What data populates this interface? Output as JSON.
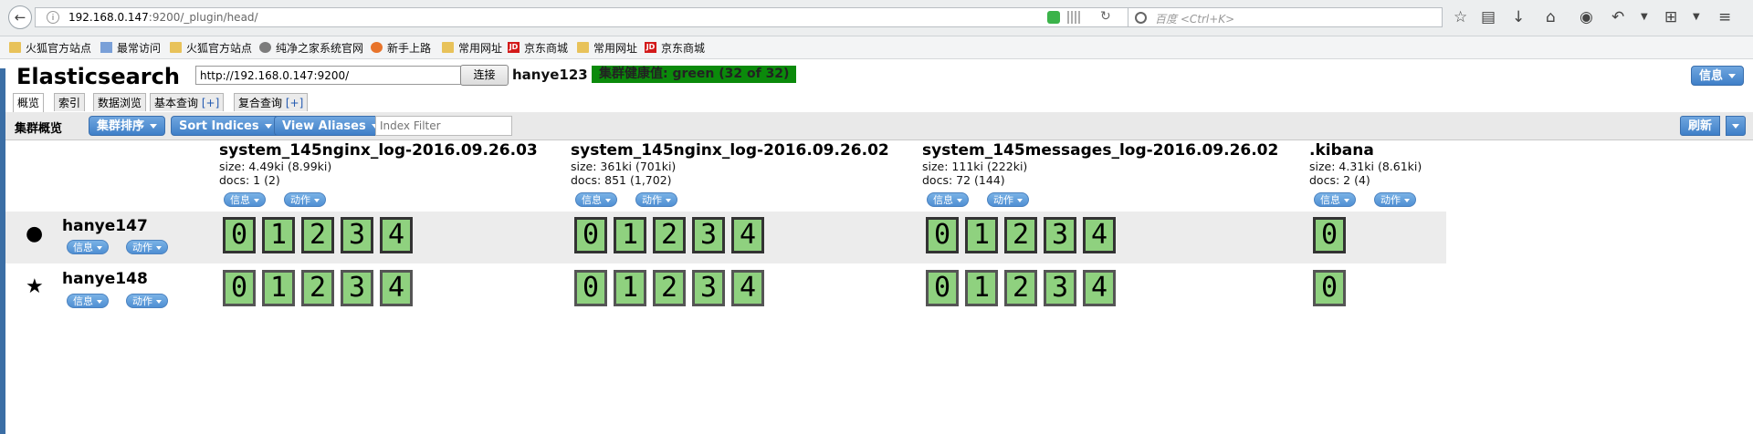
{
  "browser": {
    "url_host": "192.168.0.147",
    "url_path": ":9200/_plugin/head/",
    "search_placeholder": "百度 <Ctrl+K>",
    "bookmarks": [
      {
        "label": "火狐官方站点",
        "icon": "folder"
      },
      {
        "label": "最常访问",
        "icon": "page"
      },
      {
        "label": "火狐官方站点",
        "icon": "folder"
      },
      {
        "label": "纯净之家系统官网",
        "icon": "globe"
      },
      {
        "label": "新手上路",
        "icon": "fox"
      },
      {
        "label": "常用网址",
        "icon": "folder"
      },
      {
        "label": "京东商城",
        "icon": "jd"
      },
      {
        "label": "常用网址",
        "icon": "folder"
      },
      {
        "label": "京东商城",
        "icon": "jd"
      }
    ]
  },
  "es": {
    "title": "Elasticsearch",
    "connect_url": "http://192.168.0.147:9200/",
    "connect_label": "连接",
    "cluster_name": "hanye123",
    "health": "集群健康值: green (32 of 32)",
    "health_color": "#0b8a0b",
    "info_label": "信息",
    "tabs": [
      {
        "label": "概览"
      },
      {
        "label": "索引"
      },
      {
        "label": "数据浏览"
      },
      {
        "label": "基本查询",
        "plus": "[+]"
      },
      {
        "label": "复合查询",
        "plus": "[+]"
      }
    ],
    "toolbar": {
      "title": "集群概览",
      "sort_cluster": "集群排序",
      "sort_indices": "Sort Indices",
      "view_aliases": "View Aliases",
      "filter_placeholder": "Index Filter",
      "refresh": "刷新"
    },
    "indices": [
      {
        "name": "system_145nginx_log-2016.09.26.03",
        "size": "size: 4.49ki (8.99ki)",
        "docs": "docs: 1 (2)",
        "info": "信息",
        "action": "动作",
        "shards": [
          "0",
          "1",
          "2",
          "3",
          "4"
        ]
      },
      {
        "name": "system_145nginx_log-2016.09.26.02",
        "size": "size: 361ki (701ki)",
        "docs": "docs: 851 (1,702)",
        "info": "信息",
        "action": "动作",
        "shards": [
          "0",
          "1",
          "2",
          "3",
          "4"
        ]
      },
      {
        "name": "system_145messages_log-2016.09.26.02",
        "size": "size: 111ki (222ki)",
        "docs": "docs: 72 (144)",
        "info": "信息",
        "action": "动作",
        "shards": [
          "0",
          "1",
          "2",
          "3",
          "4"
        ]
      },
      {
        "name": ".kibana",
        "size": "size: 4.31ki (8.61ki)",
        "docs": "docs: 2 (4)",
        "info": "信息",
        "action": "动作",
        "shards": [
          "0"
        ]
      }
    ],
    "nodes": [
      {
        "name": "hanye147",
        "icon": "circle-icon",
        "info": "信息",
        "action": "动作"
      },
      {
        "name": "hanye148",
        "icon": "star-icon",
        "info": "信息",
        "action": "动作"
      }
    ],
    "accent": "#4a87cf",
    "shard_color": "#8fd17f"
  }
}
